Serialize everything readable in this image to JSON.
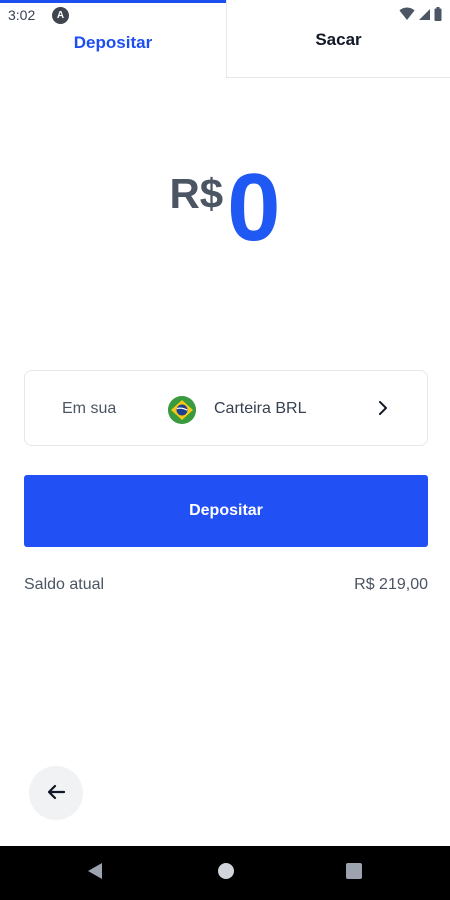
{
  "status_bar": {
    "time": "3:02",
    "app_icon_letter": "A",
    "icons": [
      "wifi-icon",
      "signal-icon",
      "battery-icon"
    ]
  },
  "tabs": [
    {
      "label": "Depositar",
      "active": true
    },
    {
      "label": "Sacar",
      "active": false
    }
  ],
  "amount": {
    "currency": "R$",
    "value": "0"
  },
  "wallet": {
    "prefix": "Em sua",
    "flag_icon": "brazil-flag-icon",
    "name": "Carteira BRL"
  },
  "deposit_button": {
    "label": "Depositar"
  },
  "balance": {
    "label": "Saldo atual",
    "value": "R$ 219,00"
  },
  "colors": {
    "accent": "#2150f5",
    "amount": "#1f58f2",
    "nav_bar": "#000000"
  }
}
